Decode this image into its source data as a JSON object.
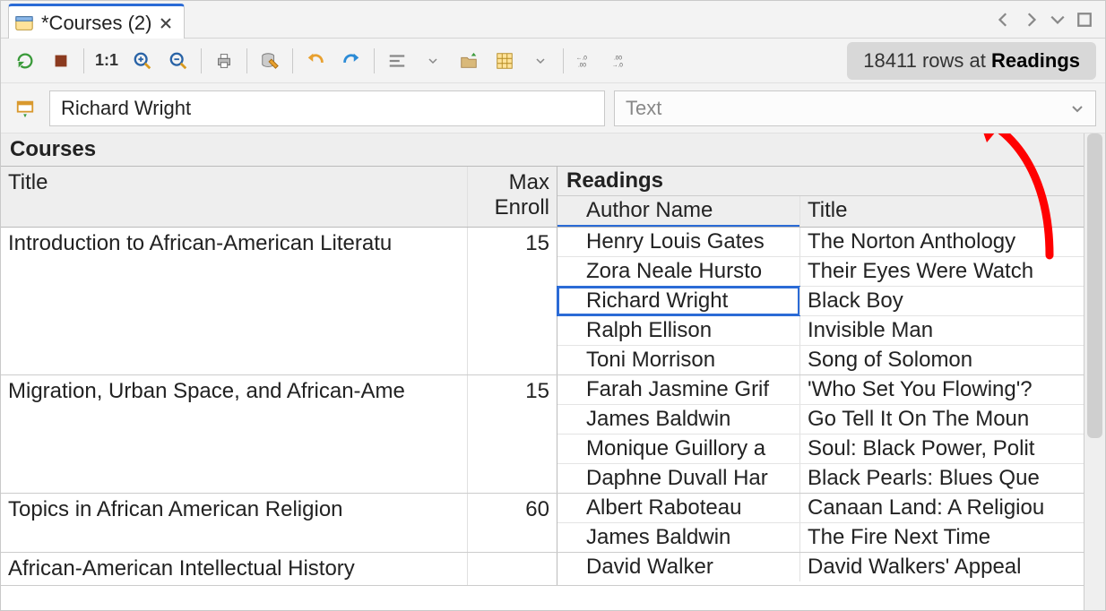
{
  "tab": {
    "title": "*Courses (2)"
  },
  "toolbar": {
    "ratio_label": "1:1"
  },
  "status_pill": {
    "prefix": "18411 rows at ",
    "bold": "Readings"
  },
  "filter": {
    "value": "Richard Wright",
    "type_placeholder": "Text"
  },
  "grid": {
    "table_name": "Courses",
    "columns": {
      "title": "Title",
      "max_enroll_line1": "Max",
      "max_enroll_line2": "Enroll"
    },
    "readings_header": "Readings",
    "readings_columns": {
      "author": "Author Name",
      "title": "Title"
    },
    "courses": [
      {
        "title": "Introduction to African-American Literatu",
        "max_enroll": "15",
        "readings": [
          {
            "author": "Henry Louis Gates",
            "title": "The Norton Anthology",
            "selected": false
          },
          {
            "author": "Zora Neale Hursto",
            "title": "Their Eyes Were Watch",
            "selected": false
          },
          {
            "author": "Richard Wright",
            "title": "Black Boy",
            "selected": true
          },
          {
            "author": "Ralph Ellison",
            "title": "Invisible Man",
            "selected": false
          },
          {
            "author": "Toni Morrison",
            "title": "Song of Solomon",
            "selected": false
          }
        ]
      },
      {
        "title": "Migration, Urban Space, and African-Ame",
        "max_enroll": "15",
        "readings": [
          {
            "author": "Farah Jasmine Grif",
            "title": "'Who Set You Flowing'?",
            "selected": false
          },
          {
            "author": "James Baldwin",
            "title": "Go Tell It On The Moun",
            "selected": false
          },
          {
            "author": "Monique Guillory a",
            "title": "Soul: Black Power, Polit",
            "selected": false
          },
          {
            "author": "Daphne Duvall Har",
            "title": "Black Pearls: Blues Que",
            "selected": false
          }
        ]
      },
      {
        "title": "Topics in African American Religion",
        "max_enroll": "60",
        "readings": [
          {
            "author": "Albert Raboteau",
            "title": "Canaan Land: A Religiou",
            "selected": false
          },
          {
            "author": "James Baldwin",
            "title": "The Fire Next Time",
            "selected": false
          }
        ]
      },
      {
        "title": "African-American Intellectual History",
        "max_enroll": "",
        "readings": [
          {
            "author": "David Walker",
            "title": "David Walkers' Appeal",
            "selected": false
          }
        ]
      }
    ]
  }
}
